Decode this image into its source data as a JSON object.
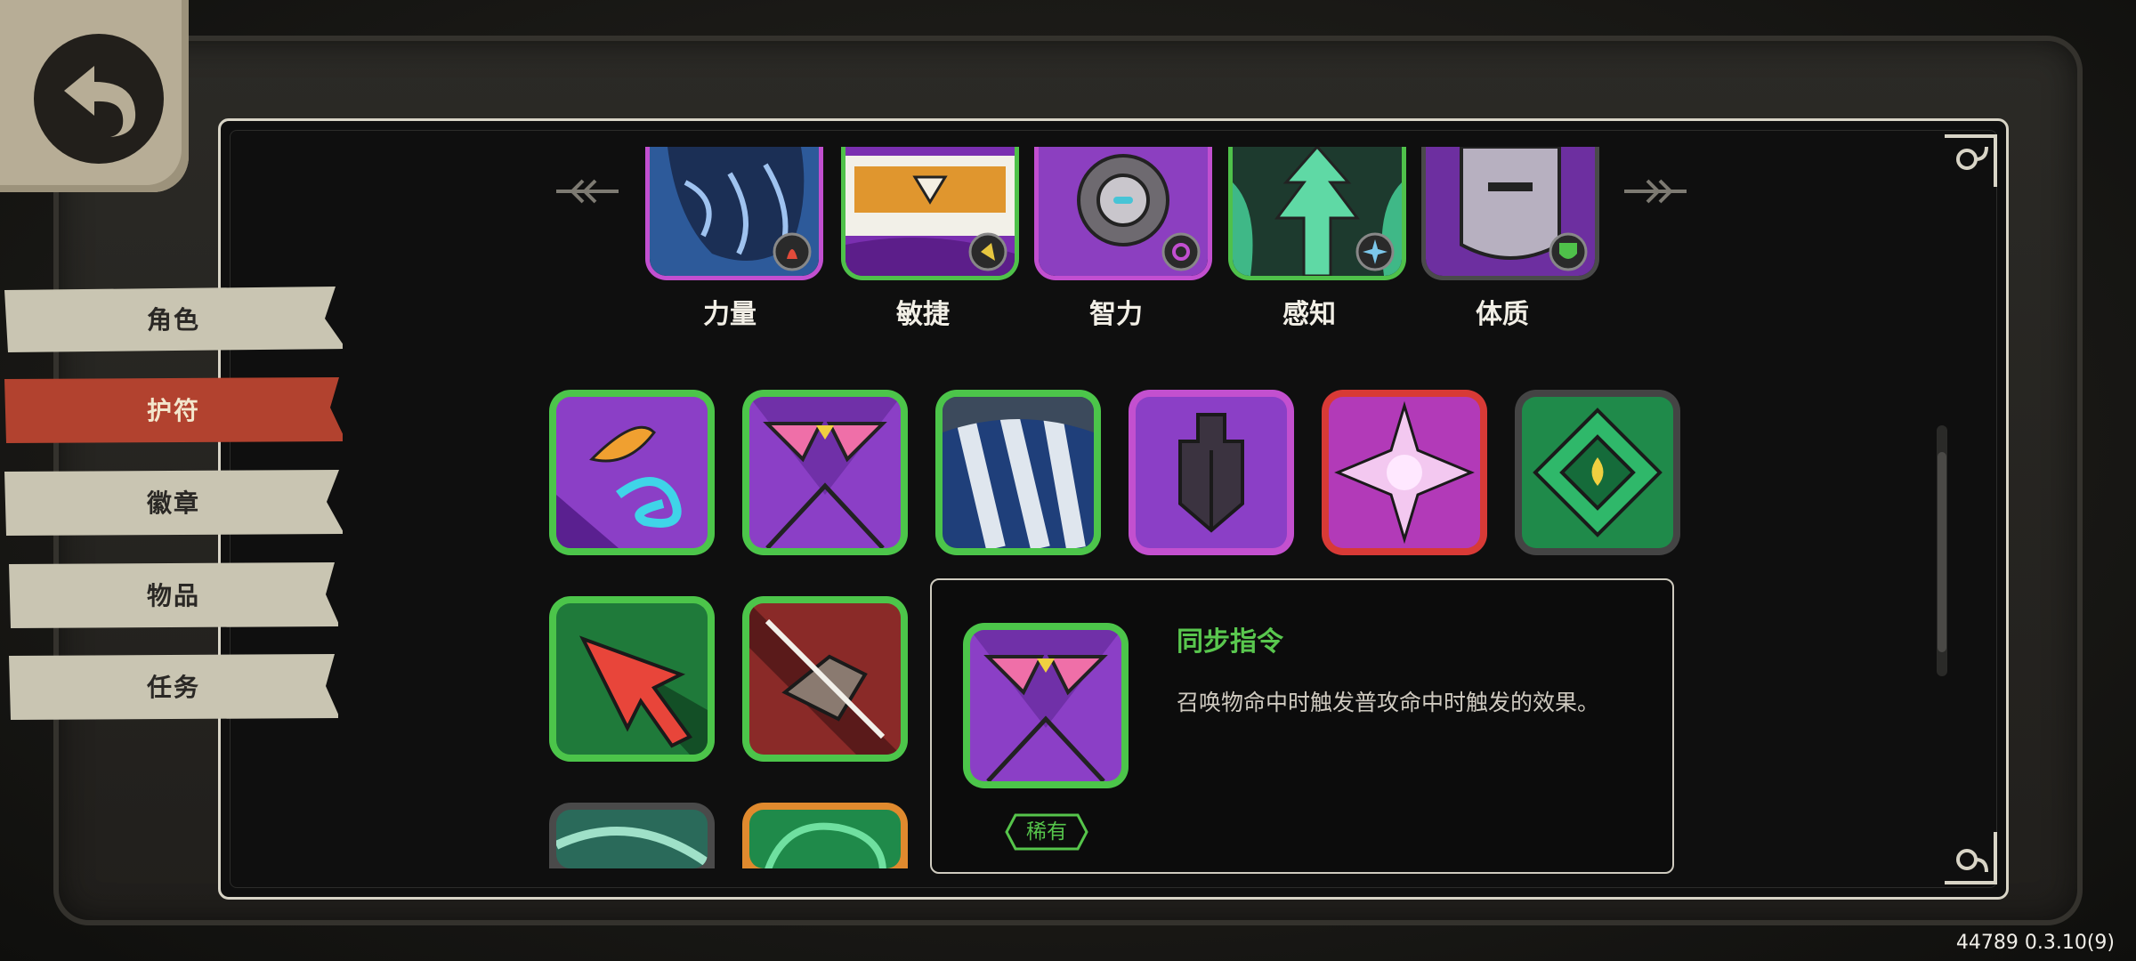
{
  "sidebar": {
    "tabs": [
      {
        "label": "角色",
        "active": false
      },
      {
        "label": "护符",
        "active": true
      },
      {
        "label": "徽章",
        "active": false
      },
      {
        "label": "物品",
        "active": false
      },
      {
        "label": "任务",
        "active": false
      }
    ]
  },
  "stats": [
    {
      "label": "力量",
      "icon": "fist-icon",
      "badge": "flame-icon",
      "border": "#c24fd0"
    },
    {
      "label": "敏捷",
      "icon": "scroll-icon",
      "badge": "dash-icon",
      "border": "#4fc14a"
    },
    {
      "label": "智力",
      "icon": "orb-icon",
      "badge": "swirl-icon",
      "border": "#c24fd0"
    },
    {
      "label": "感知",
      "icon": "tree-icon",
      "badge": "star-icon",
      "border": "#4fc14a"
    },
    {
      "label": "体质",
      "icon": "armor-icon",
      "badge": "shield-icon",
      "border": "#4a4a4a"
    }
  ],
  "charms": [
    {
      "name": "serpent-charm-icon",
      "border": "#4cc54a"
    },
    {
      "name": "sync-command-charm-icon",
      "border": "#4cc54a"
    },
    {
      "name": "ice-claw-charm-icon",
      "border": "#4cc54a"
    },
    {
      "name": "fortress-charm-icon",
      "border": "#c350cf"
    },
    {
      "name": "radiant-cross-charm-icon",
      "border": "#d83a36"
    },
    {
      "name": "emerald-eye-charm-icon",
      "border": "#444444"
    },
    {
      "name": "red-arrow-charm-icon",
      "border": "#4cc54a"
    },
    {
      "name": "shard-strike-charm-icon",
      "border": "#4cc54a"
    },
    {
      "name": "teal-slash-charm-icon",
      "border": "#4a4a4a"
    },
    {
      "name": "green-vortex-charm-icon",
      "border": "#e08a2e"
    }
  ],
  "tooltip": {
    "title": "同步指令",
    "description": "召唤物命中时触发普攻命中时触发的效果。",
    "rarity": "稀有"
  },
  "version": "44789 0.3.10(9)",
  "colors": {
    "accent_active": "#b2422f",
    "rare_green": "#56c54b",
    "tab_bg": "#c9c5b2"
  }
}
